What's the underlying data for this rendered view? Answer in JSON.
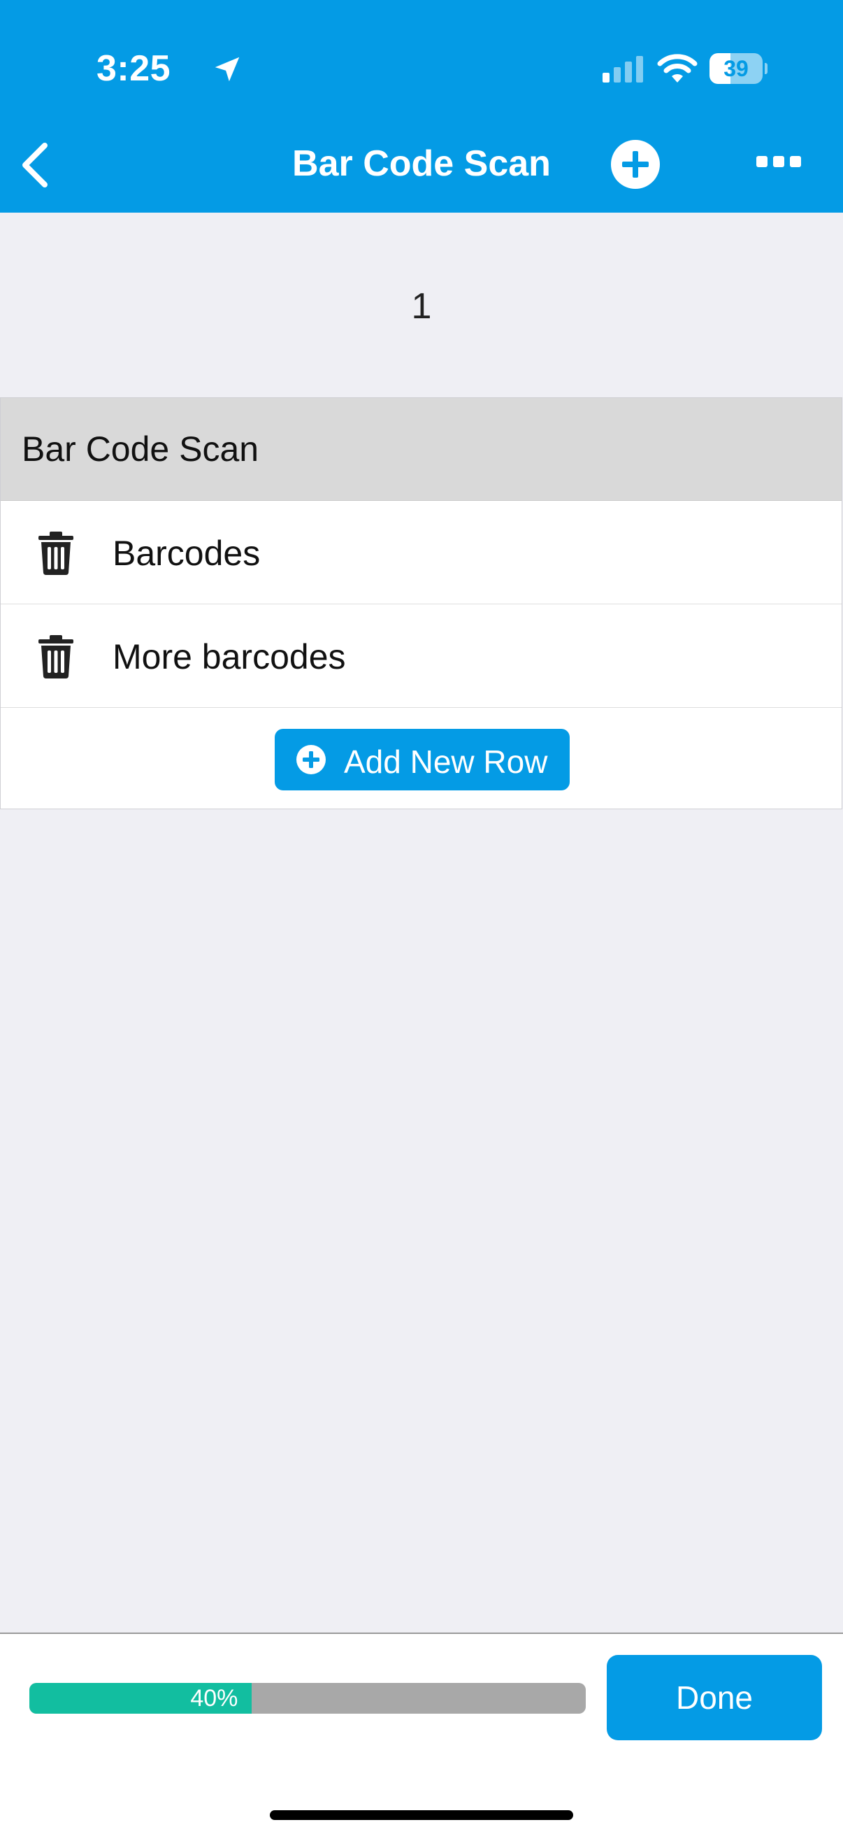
{
  "status_bar": {
    "time": "3:25",
    "battery_level": 39,
    "battery_text": "39"
  },
  "header": {
    "title": "Bar Code Scan",
    "icons": {
      "back": "chevron-left-icon",
      "add": "plus-circle-icon",
      "more": "ellipsis-icon"
    }
  },
  "page_number": "1",
  "section": {
    "title": "Bar Code Scan",
    "rows": [
      {
        "label": "Barcodes",
        "icon": "trash-icon"
      },
      {
        "label": "More barcodes",
        "icon": "trash-icon"
      }
    ],
    "add_row_label": "Add New Row"
  },
  "footer": {
    "progress_percent": 40,
    "progress_label": "40%",
    "done_label": "Done"
  },
  "colors": {
    "accent": "#049be5",
    "progress": "#12bea0",
    "progress_track": "#a8a8a8",
    "section_header": "#d9d9d9",
    "background": "#efeff4"
  }
}
